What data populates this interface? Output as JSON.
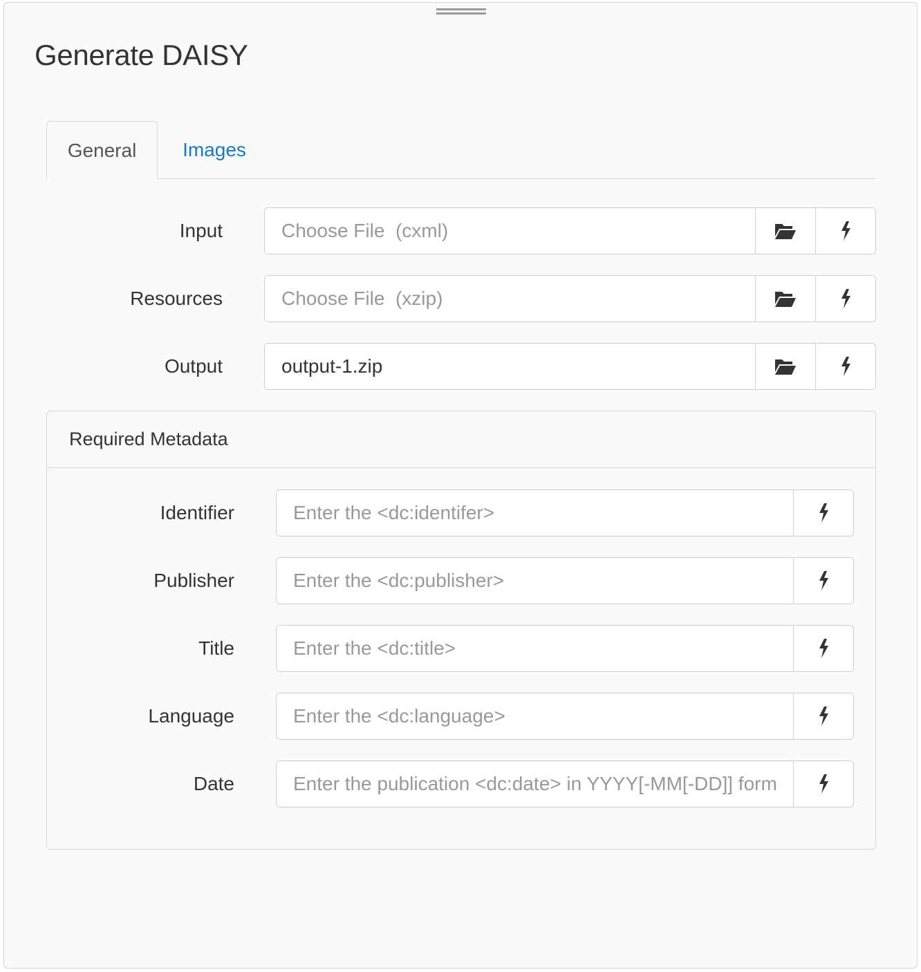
{
  "page_title": "Generate DAISY",
  "tabs": [
    {
      "label": "General",
      "active": true
    },
    {
      "label": "Images",
      "active": false
    }
  ],
  "file_fields": [
    {
      "label": "Input",
      "placeholder": "Choose File  (cxml)",
      "value": ""
    },
    {
      "label": "Resources",
      "placeholder": "Choose File  (xzip)",
      "value": ""
    },
    {
      "label": "Output",
      "placeholder": "",
      "value": "output-1.zip"
    }
  ],
  "metadata": {
    "legend": "Required Metadata",
    "fields": [
      {
        "label": "Identifier",
        "placeholder": "Enter the <dc:identifer>"
      },
      {
        "label": "Publisher",
        "placeholder": "Enter the <dc:publisher>"
      },
      {
        "label": "Title",
        "placeholder": "Enter the <dc:title>"
      },
      {
        "label": "Language",
        "placeholder": "Enter the <dc:language>"
      },
      {
        "label": "Date",
        "placeholder": "Enter the publication <dc:date> in YYYY[-MM[-DD]] format"
      }
    ]
  },
  "icons": {
    "browse": "folder-open-icon",
    "macro": "lightning-bolt-icon",
    "resize": "drag-handle-icon"
  },
  "colors": {
    "link": "#1a7abf",
    "panel_bg": "#fafafa",
    "border": "#cfcfcf"
  }
}
